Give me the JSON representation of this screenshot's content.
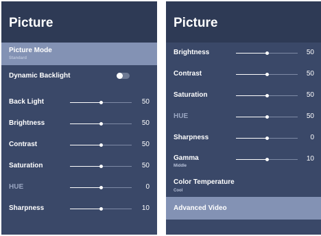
{
  "left_panel": {
    "title": "Picture",
    "picture_mode": {
      "label": "Picture Mode",
      "value": "Standard"
    },
    "dynamic_backlight": {
      "label": "Dynamic Backlight",
      "state": "off"
    },
    "sliders": [
      {
        "label": "Back Light",
        "value": "50",
        "level": 0.5
      },
      {
        "label": "Brightness",
        "value": "50",
        "level": 0.5
      },
      {
        "label": "Contrast",
        "value": "50",
        "level": 0.5
      },
      {
        "label": "Saturation",
        "value": "50",
        "level": 0.5
      },
      {
        "label": "HUE",
        "value": "0",
        "level": 0.5,
        "dim": true
      },
      {
        "label": "Sharpness",
        "value": "10",
        "level": 0.5
      }
    ]
  },
  "right_panel": {
    "title": "Picture",
    "sliders": [
      {
        "label": "Brightness",
        "value": "50",
        "level": 0.5
      },
      {
        "label": "Contrast",
        "value": "50",
        "level": 0.5
      },
      {
        "label": "Saturation",
        "value": "50",
        "level": 0.5
      },
      {
        "label": "HUE",
        "value": "50",
        "level": 0.5,
        "dim": true
      },
      {
        "label": "Sharpness",
        "value": "0",
        "level": 0.5
      },
      {
        "label": "Gamma",
        "sub": "Middle",
        "value": "10",
        "level": 0.5
      }
    ],
    "color_temperature": {
      "label": "Color Temperature",
      "value": "Cool"
    },
    "advanced_video": {
      "label": "Advanced Video"
    }
  },
  "colors": {
    "panel_bg": "#3a4868",
    "header_bg": "#2e3a55",
    "highlight_bg": "#8392b4",
    "text": "#ffffff",
    "dim_text": "#9aa6c2"
  }
}
